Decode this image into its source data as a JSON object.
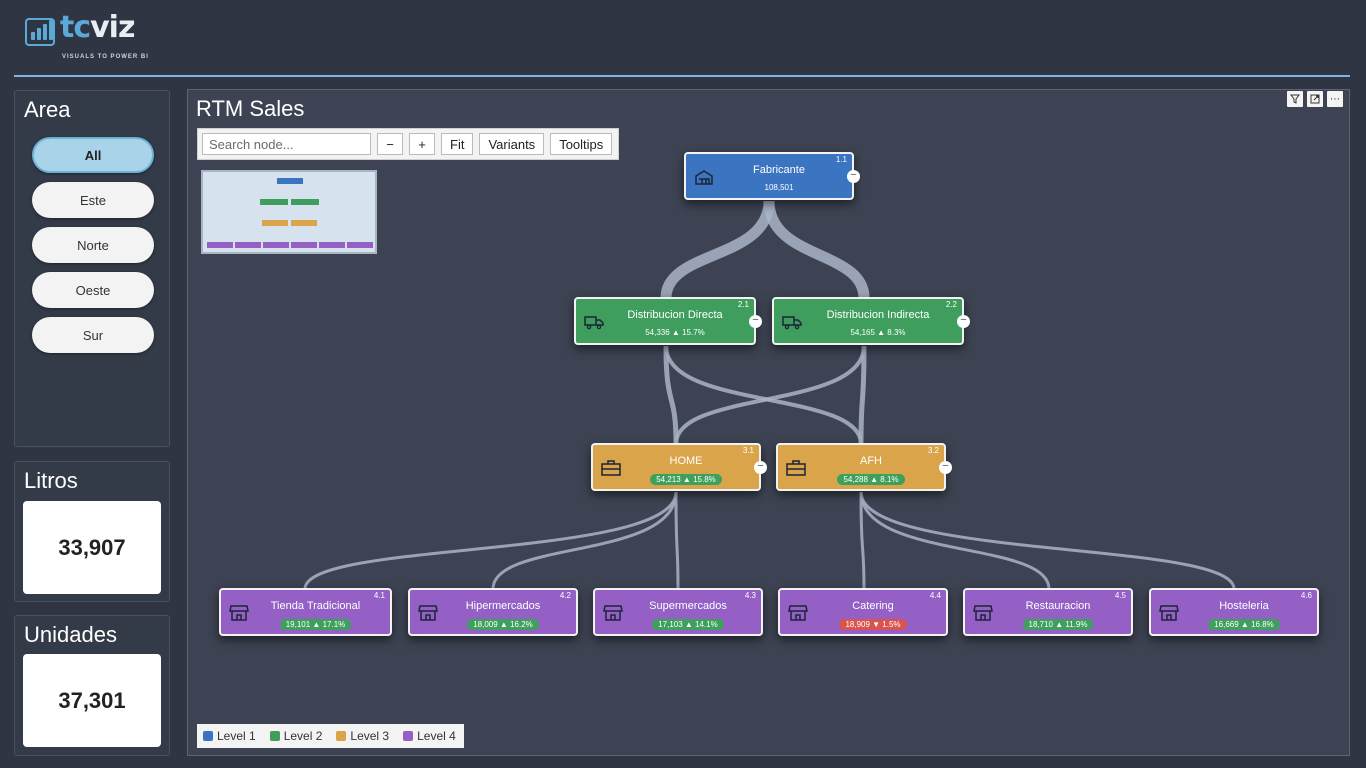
{
  "logo": {
    "brand_a": "tc",
    "brand_b": "viz",
    "tagline": "VISUALS TO POWER BI"
  },
  "area": {
    "title": "Area",
    "options": [
      {
        "label": "All",
        "active": true
      },
      {
        "label": "Este",
        "active": false
      },
      {
        "label": "Norte",
        "active": false
      },
      {
        "label": "Oeste",
        "active": false
      },
      {
        "label": "Sur",
        "active": false
      }
    ]
  },
  "kpis": {
    "litros": {
      "title": "Litros",
      "value": "33,907"
    },
    "unidades": {
      "title": "Unidades",
      "value": "37,301"
    }
  },
  "visual": {
    "title": "RTM Sales",
    "header_icons": [
      "filter-icon",
      "focus-mode-icon",
      "more-options-icon"
    ],
    "toolbar": {
      "search_placeholder": "Search node...",
      "zoom_out": "−",
      "zoom_in": "+",
      "fit": "Fit",
      "variants": "Variants",
      "tooltips": "Tooltips"
    },
    "nodes": {
      "fabricante": {
        "id": "1.1",
        "name": "Fabricante",
        "value": "108,501",
        "level": 1
      },
      "directa": {
        "id": "2.1",
        "name": "Distribucion Directa",
        "value": "54,336 ▲ 15.7%",
        "level": 2
      },
      "indirecta": {
        "id": "2.2",
        "name": "Distribucion Indirecta",
        "value": "54,165 ▲ 8.3%",
        "level": 2
      },
      "home": {
        "id": "3.1",
        "name": "HOME",
        "value": "54,213 ▲ 15.8%",
        "level": 3
      },
      "afh": {
        "id": "3.2",
        "name": "AFH",
        "value": "54,288 ▲ 8.1%",
        "level": 3
      },
      "tienda": {
        "id": "4.1",
        "name": "Tienda Tradicional",
        "value": "19,101 ▲ 17.1%",
        "level": 4
      },
      "hiper": {
        "id": "4.2",
        "name": "Hipermercados",
        "value": "18,009 ▲ 16.2%",
        "level": 4
      },
      "super": {
        "id": "4.3",
        "name": "Supermercados",
        "value": "17,103 ▲ 14.1%",
        "level": 4
      },
      "catering": {
        "id": "4.4",
        "name": "Catering",
        "value": "18,909 ▼ 1.5%",
        "level": 4
      },
      "restauracion": {
        "id": "4.5",
        "name": "Restauracion",
        "value": "18,710 ▲ 11.9%",
        "level": 4
      },
      "hosteleria": {
        "id": "4.6",
        "name": "Hosteleria",
        "value": "16,669 ▲ 16.8%",
        "level": 4
      }
    },
    "legend": [
      {
        "label": "Level 1",
        "color": "#3b74c0"
      },
      {
        "label": "Level 2",
        "color": "#3f9e5e"
      },
      {
        "label": "Level 3",
        "color": "#d9a44a"
      },
      {
        "label": "Level 4",
        "color": "#9460c6"
      }
    ],
    "collapse_symbol": "−"
  },
  "colors": {
    "level1": "#3b74c0",
    "level2": "#3f9e5e",
    "level3": "#d9a44a",
    "level4": "#9460c6",
    "positive": "#3fa05d",
    "negative": "#d9534f",
    "accent": "#7fb6dc"
  }
}
